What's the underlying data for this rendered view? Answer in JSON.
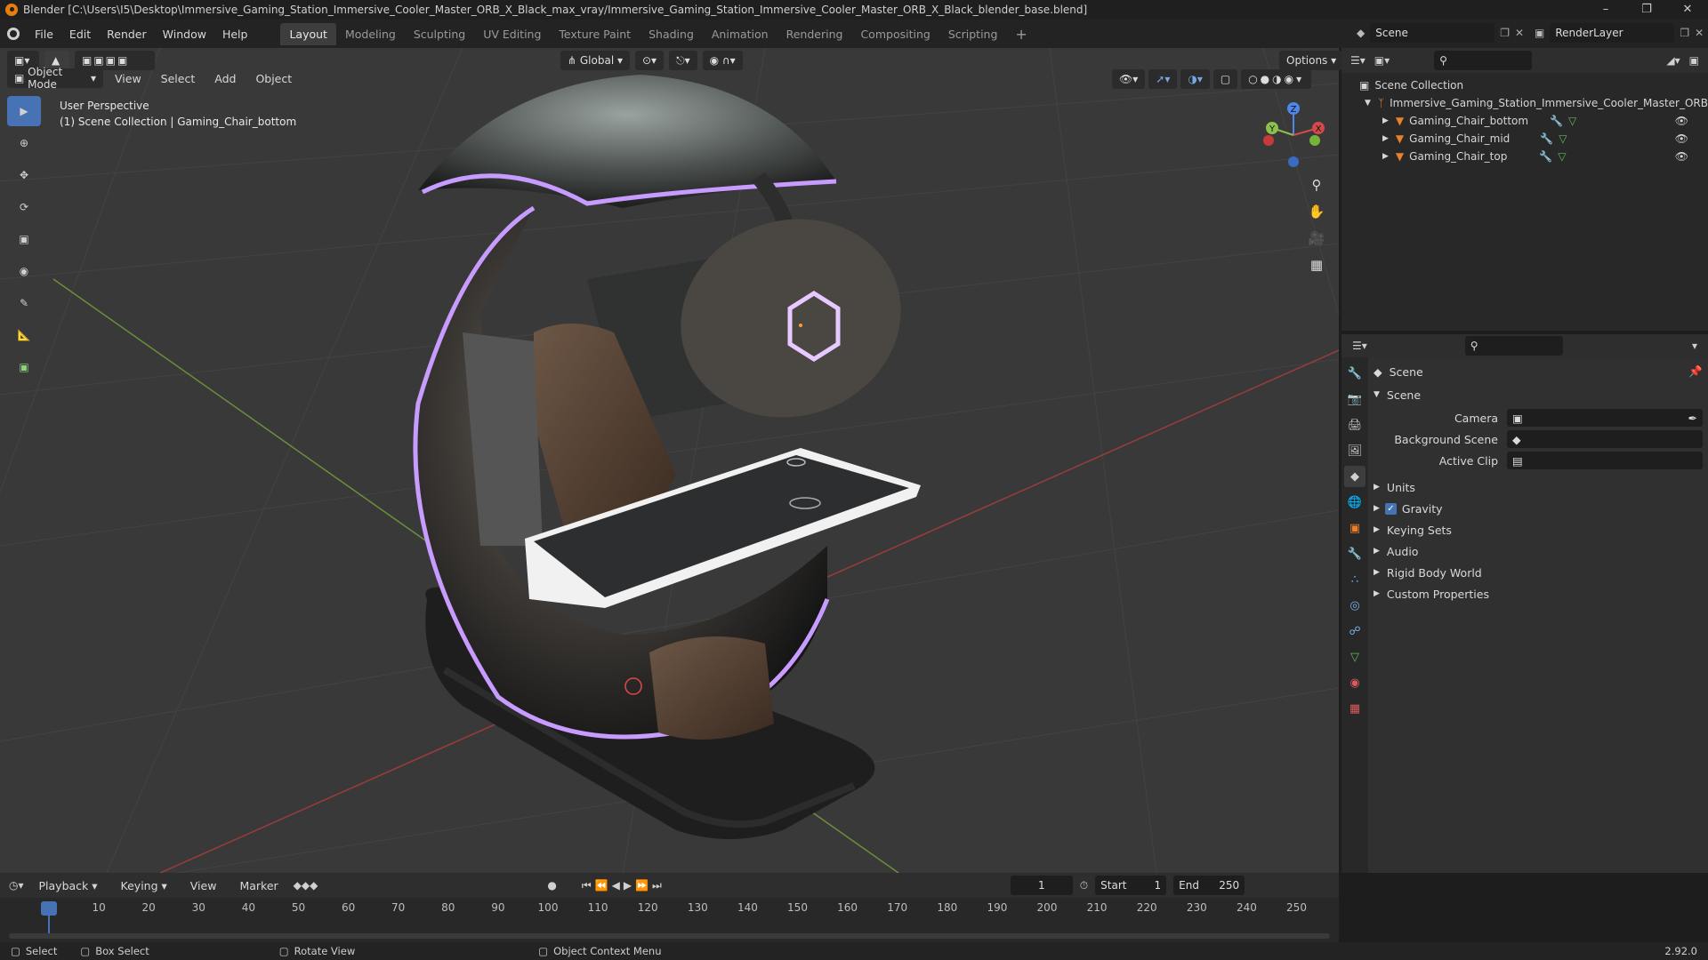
{
  "title": "Blender [C:\\Users\\I5\\Desktop\\Immersive_Gaming_Station_Immersive_Cooler_Master_ORB_X_Black_max_vray/Immersive_Gaming_Station_Immersive_Cooler_Master_ORB_X_Black_blender_base.blend]",
  "menus": [
    "File",
    "Edit",
    "Render",
    "Window",
    "Help"
  ],
  "workspaces": [
    "Layout",
    "Modeling",
    "Sculpting",
    "UV Editing",
    "Texture Paint",
    "Shading",
    "Animation",
    "Rendering",
    "Compositing",
    "Scripting"
  ],
  "active_workspace": "Layout",
  "scene_field": "Scene",
  "renderlayer_field": "RenderLayer",
  "transform_orientation": "Global",
  "options_label": "Options",
  "viewport": {
    "mode": "Object Mode",
    "menus": [
      "View",
      "Select",
      "Add",
      "Object"
    ],
    "overlay_line1": "User Perspective",
    "overlay_line2": "(1) Scene Collection | Gaming_Chair_bottom",
    "gizmo_labels": {
      "z": "Z",
      "y": "Y",
      "x": "X"
    }
  },
  "outliner": {
    "root": "Scene Collection",
    "collection": "Immersive_Gaming_Station_Immersive_Cooler_Master_ORB",
    "objects": [
      "Gaming_Chair_bottom",
      "Gaming_Chair_mid",
      "Gaming_Chair_top"
    ]
  },
  "properties": {
    "header": "Scene",
    "panel": "Scene",
    "camera_label": "Camera",
    "background_label": "Background Scene",
    "clip_label": "Active Clip",
    "subpanels": [
      "Units",
      "Gravity",
      "Keying Sets",
      "Audio",
      "Rigid Body World",
      "Custom Properties"
    ],
    "gravity_checked": true
  },
  "timeline": {
    "menus": [
      "Playback",
      "Keying",
      "View",
      "Marker"
    ],
    "current_frame": "1",
    "start_label": "Start",
    "start": "1",
    "end_label": "End",
    "end": "250",
    "ticks": [
      "1",
      "10",
      "20",
      "30",
      "40",
      "50",
      "60",
      "70",
      "80",
      "90",
      "100",
      "110",
      "120",
      "130",
      "140",
      "150",
      "160",
      "170",
      "180",
      "190",
      "200",
      "210",
      "220",
      "230",
      "240",
      "250"
    ]
  },
  "statusbar": {
    "select": "Select",
    "box_select": "Box Select",
    "rotate": "Rotate View",
    "context": "Object Context Menu",
    "version": "2.92.0"
  },
  "colors": {
    "accent": "#4772b3",
    "object_orange": "#e8812b",
    "mesh_green": "#5cbd5a",
    "neon": "#c89bff"
  }
}
